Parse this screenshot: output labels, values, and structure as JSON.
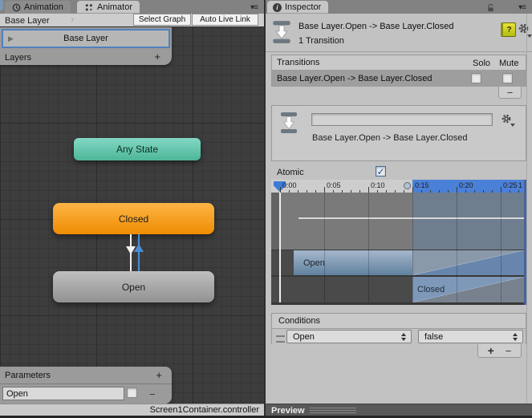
{
  "animator": {
    "tab_animation": "Animation",
    "tab_animator": "Animator",
    "breadcrumb": "Base Layer",
    "select_graph_button": "Select Graph",
    "auto_live_link_button": "Auto Live Link",
    "selected_layer": "Base Layer",
    "layers_label": "Layers",
    "nodes": {
      "any_state": "Any State",
      "closed": "Closed",
      "open": "Open"
    },
    "parameters_label": "Parameters",
    "parameter_name": "Open",
    "status_file": "Screen1Container.controller"
  },
  "inspector": {
    "tab": "Inspector",
    "title": "Base Layer.Open -> Base Layer.Closed",
    "subtitle": "1 Transition",
    "transitions_header": "Transitions",
    "solo_label": "Solo",
    "mute_label": "Mute",
    "transition_row": "Base Layer.Open -> Base Layer.Closed",
    "transition_name_value": "",
    "transition_label": "Base Layer.Open -> Base Layer.Closed",
    "atomic_label": "Atomic",
    "timeline": {
      "ticks": [
        "0:00",
        "0:05",
        "0:10",
        "0:15",
        "0:20",
        "0:25"
      ],
      "edge_tick": "1",
      "source_track": "Open",
      "target_track": "Closed"
    },
    "conditions_header": "Conditions",
    "condition_parameter": "Open",
    "condition_value": "false",
    "preview_label": "Preview"
  },
  "icons": {
    "plus": "+",
    "minus": "−",
    "play": "▶",
    "menu": "▾≡",
    "chevron": "›",
    "check": "✓",
    "info": "i",
    "help": "?"
  },
  "colors": {
    "accent_blue": "#4b80d8",
    "selection_border": "#4f81bd",
    "node_teal": "#63c7ae",
    "node_orange": "#f59b1f",
    "transition_blue": "#4a90d9"
  }
}
